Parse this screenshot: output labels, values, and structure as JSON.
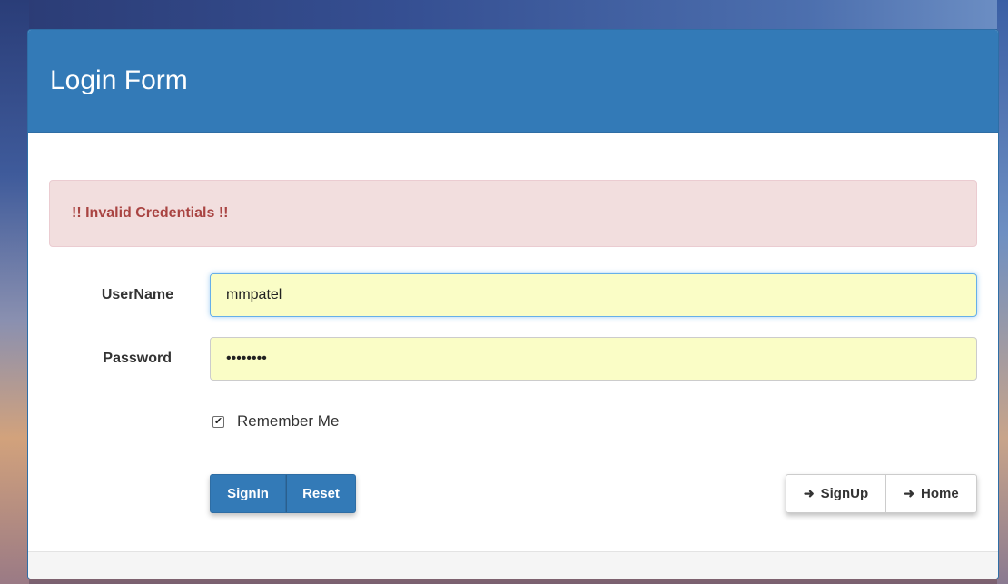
{
  "form": {
    "title": "Login Form",
    "alert": "!! Invalid Credentials !!",
    "username_label": "UserName",
    "username_value": "mmpatel",
    "password_label": "Password",
    "password_value": "••••••••",
    "remember_label": "Remember Me",
    "remember_checked": true
  },
  "buttons": {
    "signin": "SignIn",
    "reset": "Reset",
    "signup": "SignUp",
    "home": "Home",
    "arrow_glyph": "➜"
  },
  "colors": {
    "primary": "#337ab7",
    "alert_bg": "#f2dede",
    "alert_text": "#a94442",
    "autofill_bg": "#fafdc6"
  }
}
